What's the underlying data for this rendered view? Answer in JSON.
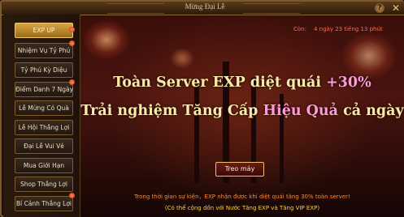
{
  "window": {
    "title": "Mừng Đại Lễ",
    "help_icon": "?",
    "close_icon": "✕"
  },
  "sidebar": {
    "items": [
      {
        "label": "EXP UP",
        "active": true,
        "badge": true
      },
      {
        "label": "Nhiệm Vụ Tỷ Phú",
        "active": false,
        "badge": true
      },
      {
        "label": "Tỷ Phú Kỳ Diệu",
        "active": false,
        "badge": false
      },
      {
        "label": "Điểm Danh 7 Ngày",
        "active": false,
        "badge": true
      },
      {
        "label": "Lễ Mừng Có Quà",
        "active": false,
        "badge": false
      },
      {
        "label": "Lễ Hội Thắng Lợi",
        "active": false,
        "badge": false
      },
      {
        "label": "Đại Lễ Vui Vẻ",
        "active": false,
        "badge": false
      },
      {
        "label": "Mua Giới Hạn",
        "active": false,
        "badge": false
      },
      {
        "label": "Shop Thắng Lợi",
        "active": false,
        "badge": false
      },
      {
        "label": "Bí Cảnh Thắng Lợi",
        "active": false,
        "badge": true
      }
    ]
  },
  "main": {
    "countdown_label": "Còn:",
    "countdown_value": "4 ngày 23 tiếng 13 phút",
    "headline1_prefix": "Toàn Server EXP diệt quái",
    "headline1_highlight": "+30%",
    "headline2_prefix": "Trải nghiệm Tăng Cấp",
    "headline2_highlight": "Hiệu Quả",
    "headline2_suffix": "cả ngày",
    "action_button": "Treo máy",
    "note1": "Trong thời gian sự kiện，EXP nhận được khi diệt quái tăng 30% toàn server!",
    "note2": "(Có thể cộng dồn với Nước Tăng EXP và Tăng VIP EXP)"
  },
  "colors": {
    "accent_gold": "#e8c070",
    "active_tab": "#d9a542",
    "highlight_pink": "#ff9ad8",
    "timer_red": "#ff6a4a",
    "note_orange": "#ff8a30",
    "note_yellow": "#ffd24a"
  }
}
